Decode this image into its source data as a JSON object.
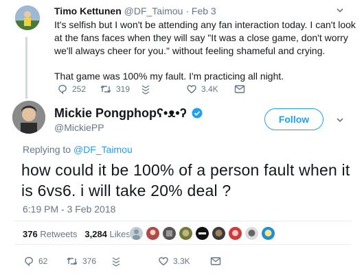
{
  "tweet1": {
    "name": "Timo Kettunen",
    "handle": "@DF_Taimou",
    "date": "Feb 3",
    "body": [
      "It's selfish but I won't be attending any fan interaction today. I can't look at the fans faces when they will say \"It was a close game, don't worry we'll always cheer for you.\" without feeling shameful and crying.",
      "That game was 100% my fault. I'm practicing all night."
    ],
    "replies": "252",
    "retweets": "319",
    "likes": "3.4K"
  },
  "tweet2": {
    "name": "Mickie Pongphop",
    "name_emoji": "ʕ•ᴥ•ʔ",
    "handle": "@MickiePP",
    "follow_label": "Follow",
    "replying_prefix": "Replying to",
    "replying_to": "@DF_Taimou",
    "text": "how could it be 100% of a person fault when it is 6vs6. i will take 20% deal ?",
    "timestamp": "6:19 PM - 3 Feb 2018",
    "retweets_count": "376",
    "retweets_label": "Retweets",
    "likes_count": "3,284",
    "likes_label": "Likes",
    "replies": "62",
    "retweets": "376",
    "likes": "3.3K"
  },
  "colors": {
    "accent": "#1da1f2",
    "muted": "#657786",
    "verified": "#1da1f2"
  },
  "icons": [
    "reply-icon",
    "retweet-icon",
    "dm-icon",
    "like-icon",
    "mail-icon",
    "verified-icon",
    "chevron-down-icon"
  ]
}
